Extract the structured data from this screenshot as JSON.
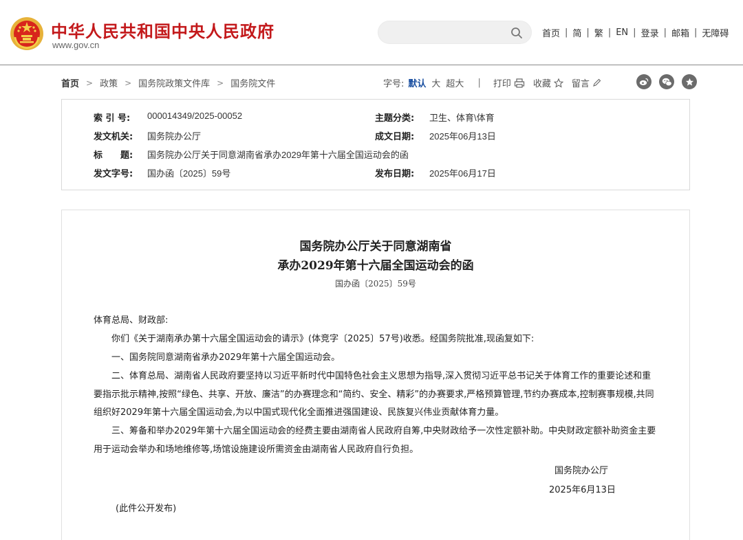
{
  "header": {
    "site_title": "中华人民共和国中央人民政府",
    "site_url": "www.gov.cn",
    "search": {
      "value": "",
      "placeholder": ""
    },
    "nav": [
      "首页",
      "简",
      "繁",
      "EN",
      "登录",
      "邮箱",
      "无障碍"
    ]
  },
  "breadcrumb": [
    "首页",
    "政策",
    "国务院政策文件库",
    "国务院文件"
  ],
  "tools": {
    "font_label": "字号:",
    "font_sizes": [
      "默认",
      "大",
      "超大"
    ],
    "print_label": "打印",
    "favorite_label": "收藏",
    "comment_label": "留言"
  },
  "share": [
    "weibo-icon",
    "wechat-icon",
    "star-icon"
  ],
  "info": {
    "index_label": "索 引 号:",
    "index_value": "000014349/2025-00052",
    "category_label": "主题分类:",
    "category_value": "卫生、体育\\体育",
    "issuer_label": "发文机关:",
    "issuer_value": "国务院办公厅",
    "written_date_label": "成文日期:",
    "written_date_value": "2025年06月13日",
    "title_label": "标　　题:",
    "title_value": "国务院办公厅关于同意湖南省承办2029年第十六届全国运动会的函",
    "doc_number_label": "发文字号:",
    "doc_number_value": "国办函〔2025〕59号",
    "publish_date_label": "发布日期:",
    "publish_date_value": "2025年06月17日"
  },
  "document": {
    "title_line1": "国务院办公厅关于同意湖南省",
    "title_line2": "承办2029年第十六届全国运动会的函",
    "doc_number": "国办函〔2025〕59号",
    "salutation": "体育总局、财政部:",
    "paragraphs": [
      "你们《关于湖南承办第十六届全国运动会的请示》(体竞字〔2025〕57号)收悉。经国务院批准,现函复如下:",
      "一、国务院同意湖南省承办2029年第十六届全国运动会。",
      "二、体育总局、湖南省人民政府要坚持以习近平新时代中国特色社会主义思想为指导,深入贯彻习近平总书记关于体育工作的重要论述和重要指示批示精神,按照“绿色、共享、开放、廉洁”的办赛理念和“简约、安全、精彩”的办赛要求,严格预算管理,节约办赛成本,控制赛事规模,共同组织好2029年第十六届全国运动会,为以中国式现代化全面推进强国建设、民族复兴伟业贡献体育力量。",
      "三、筹备和举办2029年第十六届全国运动会的经费主要由湖南省人民政府自筹,中央财政给予一次性定额补助。中央财政定额补助资金主要用于运动会举办和场地维修等,场馆设施建设所需资金由湖南省人民政府自行负担。"
    ],
    "signer": "国务院办公厅",
    "sign_date": "2025年6月13日",
    "note": "(此件公开发布)"
  }
}
